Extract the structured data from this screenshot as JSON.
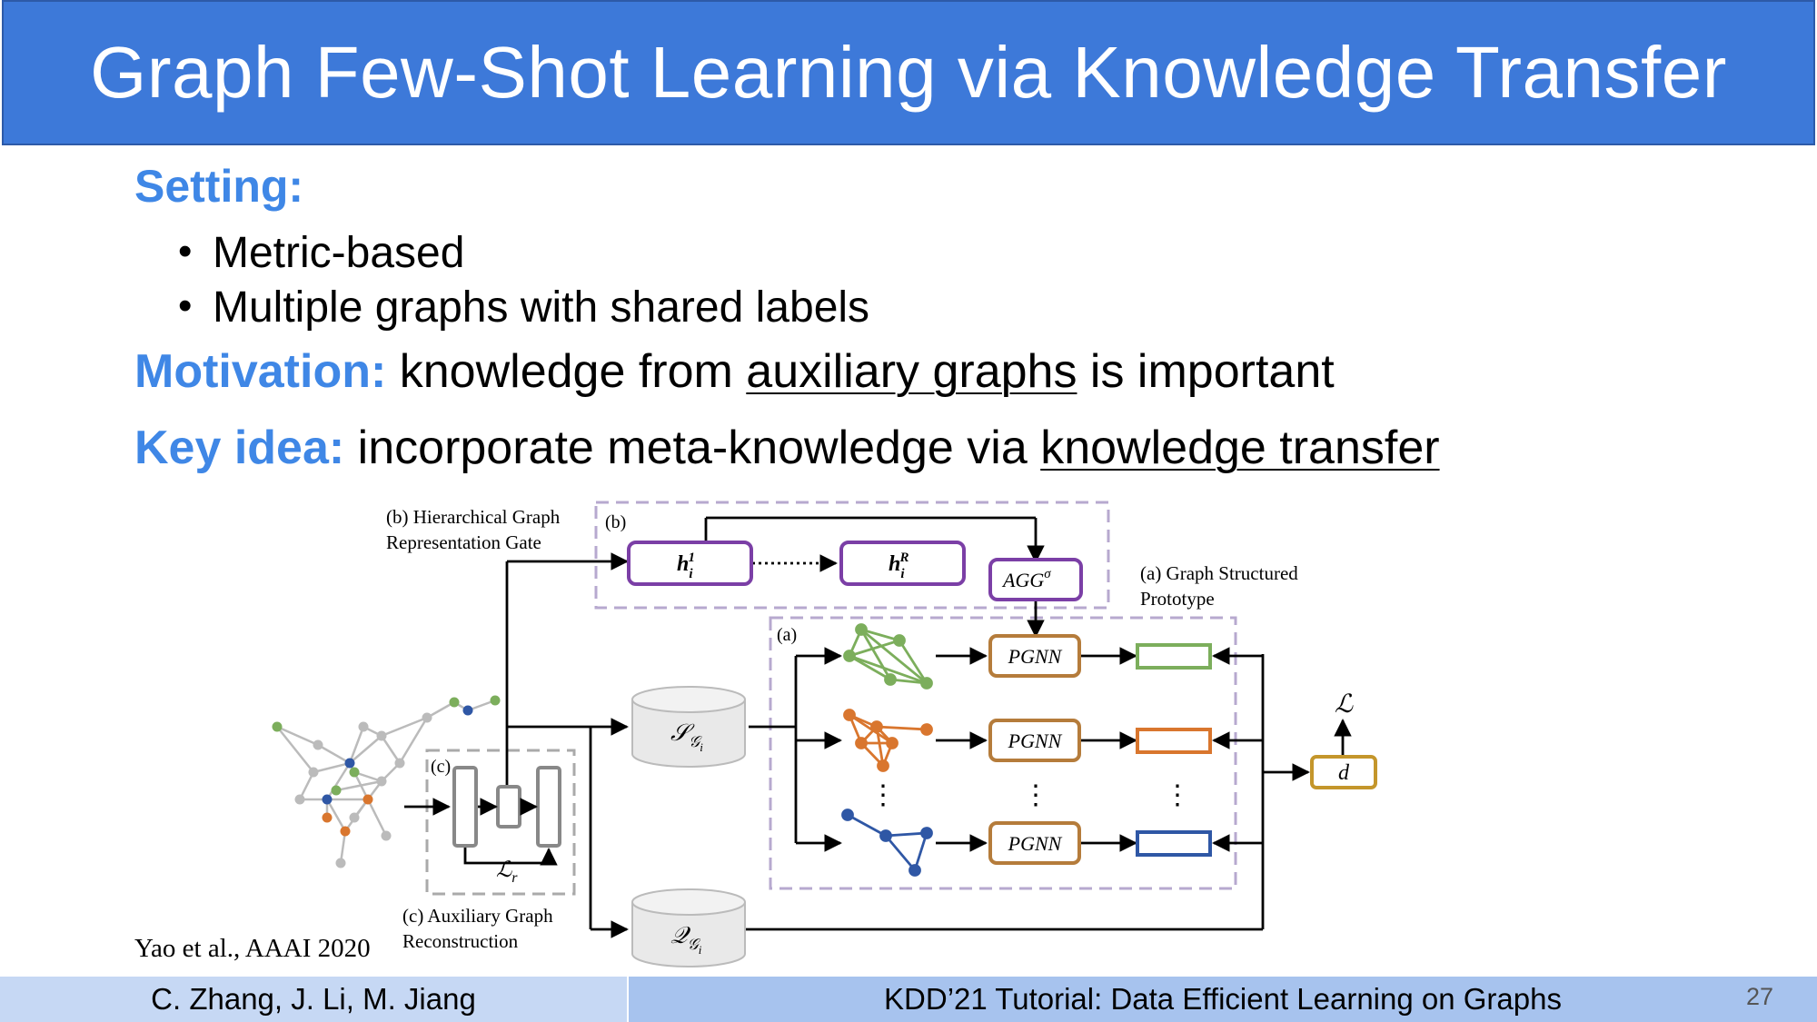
{
  "colors": {
    "title_bg": "#3d79d9",
    "heading": "#3f87e6",
    "footer_left_bg": "#c6d8f4",
    "footer_right_bg": "#a7c3ee",
    "purple": "#7b3fa6",
    "gold": "#c4962b",
    "brown": "#b57c3b",
    "green": "#7cae5c",
    "orange": "#d9762e",
    "blue": "#2f57a5",
    "dash": "#b7a9cf"
  },
  "slide": {
    "title": "Graph Few-Shot Learning via Knowledge Transfer",
    "setting_label": "Setting:",
    "bullets": [
      "Metric-based",
      "Multiple graphs with shared labels"
    ],
    "motivation": {
      "label": "Motivation:",
      "pre": "knowledge from",
      "underlined": "auxiliary graphs",
      "post": "is important"
    },
    "key_idea": {
      "label": "Key idea:",
      "pre": "incorporate meta-knowledge via",
      "underlined": "knowledge transfer"
    }
  },
  "figure": {
    "label_b_line1": "(b) Hierarchical Graph",
    "label_b_line2": "Representation Gate",
    "label_b_box": "(b)",
    "label_a_line1": "(a) Graph Structured",
    "label_a_line2": "Prototype",
    "label_a_box": "(a)",
    "label_c_box": "(c)",
    "label_c_line1": "(c) Auxiliary Graph",
    "label_c_line2": "Reconstruction",
    "h1": "h",
    "h1_sup": "1",
    "h1_sub": "i",
    "hR": "h",
    "hR_sup": "R",
    "hR_sub": "i",
    "agg": "AGG",
    "agg_sup": "σ",
    "pgnn": "PGNN",
    "loss": "ℒ",
    "loss_r": "ℒ",
    "loss_r_sub": "r",
    "d": "d",
    "support": "𝒮",
    "support_sub": "𝒢",
    "support_subsub": "i",
    "query": "𝒬",
    "query_sub": "𝒢",
    "query_subsub": "i",
    "dots": "⋮"
  },
  "citation": "Yao et al., AAAI 2020",
  "footer": {
    "authors": "C. Zhang, J. Li, M. Jiang",
    "event": "KDD’21 Tutorial: Data Efficient Learning on Graphs",
    "page": "27"
  }
}
